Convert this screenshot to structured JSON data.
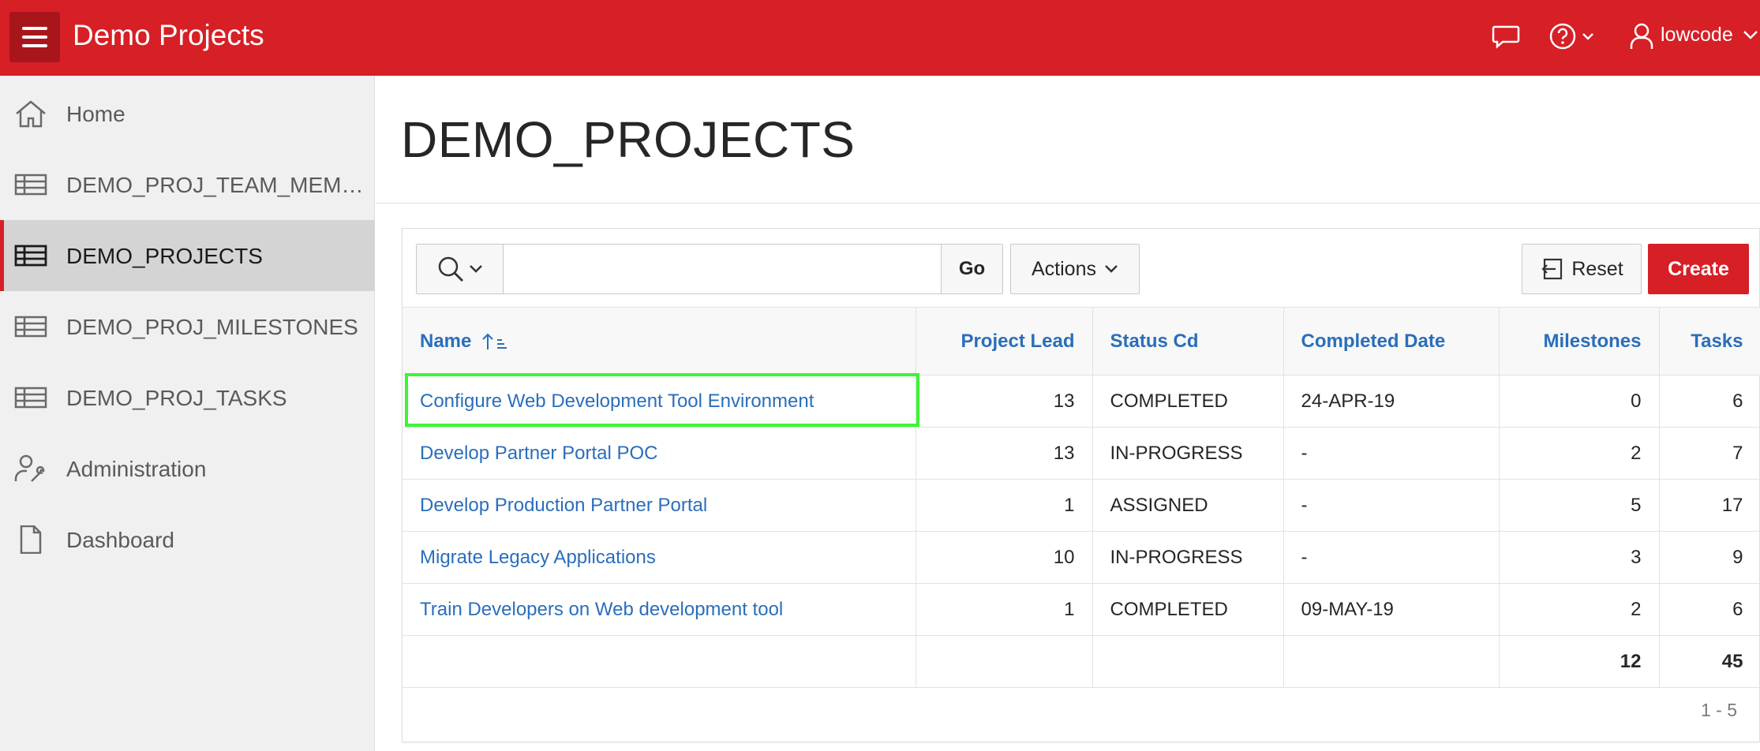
{
  "header": {
    "app_title": "Demo Projects",
    "user_name": "lowcode",
    "icons": [
      "menu-icon",
      "chat-icon",
      "help-icon",
      "user-icon"
    ]
  },
  "sidebar": {
    "items": [
      {
        "label": "Home",
        "icon": "home-icon",
        "active": false
      },
      {
        "label": "DEMO_PROJ_TEAM_MEMBERS",
        "icon": "table-icon",
        "active": false
      },
      {
        "label": "DEMO_PROJECTS",
        "icon": "table-icon",
        "active": true
      },
      {
        "label": "DEMO_PROJ_MILESTONES",
        "icon": "table-icon",
        "active": false
      },
      {
        "label": "DEMO_PROJ_TASKS",
        "icon": "table-icon",
        "active": false
      },
      {
        "label": "Administration",
        "icon": "user-wrench-icon",
        "active": false
      },
      {
        "label": "Dashboard",
        "icon": "file-icon",
        "active": false
      }
    ]
  },
  "main": {
    "page_title": "DEMO_PROJECTS",
    "toolbar": {
      "search_value": "",
      "go_label": "Go",
      "actions_label": "Actions",
      "reset_label": "Reset",
      "create_label": "Create"
    },
    "table": {
      "columns": [
        "Name",
        "Project Lead",
        "Status Cd",
        "Completed Date",
        "Milestones",
        "Tasks"
      ],
      "rows": [
        {
          "name": "Configure Web Development Tool Environment",
          "lead": "13",
          "status": "COMPLETED",
          "completed": "24-APR-19",
          "milestones": "0",
          "tasks": "6"
        },
        {
          "name": "Develop Partner Portal POC",
          "lead": "13",
          "status": "IN-PROGRESS",
          "completed": "-",
          "milestones": "2",
          "tasks": "7"
        },
        {
          "name": "Develop Production Partner Portal",
          "lead": "1",
          "status": "ASSIGNED",
          "completed": "-",
          "milestones": "5",
          "tasks": "17"
        },
        {
          "name": "Migrate Legacy Applications",
          "lead": "10",
          "status": "IN-PROGRESS",
          "completed": "-",
          "milestones": "3",
          "tasks": "9"
        },
        {
          "name": "Train Developers on Web development tool",
          "lead": "1",
          "status": "COMPLETED",
          "completed": "09-MAY-19",
          "milestones": "2",
          "tasks": "6"
        }
      ],
      "totals": {
        "milestones": "12",
        "tasks": "45"
      },
      "pagination": "1 - 5"
    },
    "accent_color": "#d71f26",
    "link_color": "#2a6ebb",
    "highlight_color": "#3cf535"
  }
}
